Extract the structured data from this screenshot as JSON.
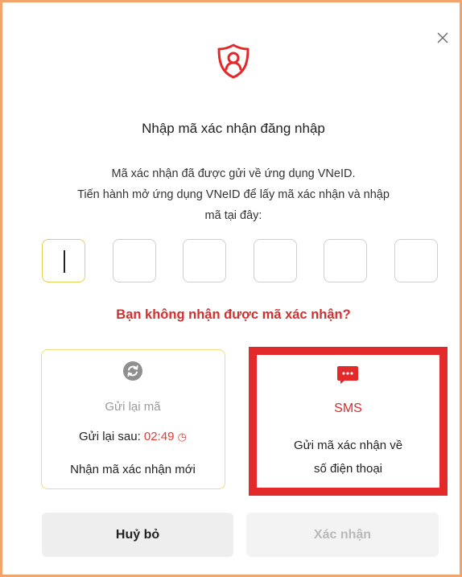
{
  "dialog": {
    "close_label": "X",
    "title": "Nhập mã xác nhận đăng nhập",
    "description": [
      "Mã xác nhận đã được gửi về ứng dụng VNeID.",
      "Tiến hành mở ứng dụng VNeID để lấy mã xác nhận và nhập",
      "mã tại đây:"
    ],
    "otp_digits": [
      "",
      "",
      "",
      "",
      "",
      ""
    ],
    "no_code_prompt": "Bạn không nhận được mã xác nhận?"
  },
  "resend": {
    "title": "Gửi lại mã",
    "countdown_label": "Gửi lại sau:",
    "countdown_time": "02:49",
    "subtitle": "Nhận mã xác nhận mới"
  },
  "sms": {
    "title": "SMS",
    "description": [
      "Gửi mã xác nhận về",
      "số điện thoại"
    ]
  },
  "buttons": {
    "cancel": "Huỷ bỏ",
    "confirm": "Xác nhận"
  },
  "colors": {
    "accent_red": "#e32929",
    "active_border": "#e8cf55",
    "window_border": "#f2a56b"
  },
  "icons": [
    "close-icon",
    "shield-user-icon",
    "refresh-icon",
    "clock-icon",
    "sms-message-icon"
  ]
}
